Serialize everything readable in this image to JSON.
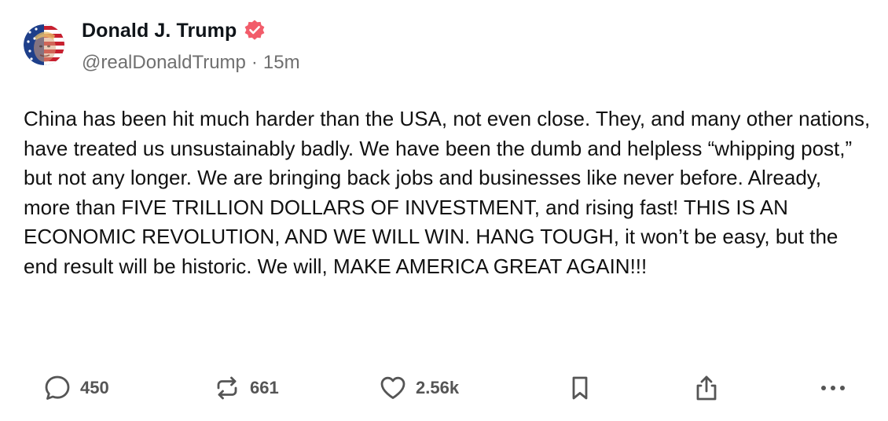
{
  "author": {
    "display_name": "Donald J. Trump",
    "handle": "@realDonaldTrump",
    "separator": "·",
    "timestamp": "15m",
    "verified": true,
    "verified_color": "#f25c6a"
  },
  "post": {
    "text": "China has been hit much harder than the USA, not even close. They, and many other nations, have treated us unsustainably badly. We have been the dumb and helpless “whipping post,” but not any longer. We are bringing back jobs and businesses like never before. Already, more than FIVE TRILLION DOLLARS OF INVESTMENT, and rising fast! THIS IS AN ECONOMIC REVOLUTION, AND WE WILL WIN. HANG TOUGH, it won’t be easy, but the end result will be historic. We will, MAKE AMERICA GREAT AGAIN!!!"
  },
  "actions": {
    "reply": {
      "icon": "reply-icon",
      "count": "450"
    },
    "repost": {
      "icon": "repost-icon",
      "count": "661"
    },
    "like": {
      "icon": "heart-icon",
      "count": "2.56k"
    },
    "bookmark": {
      "icon": "bookmark-icon"
    },
    "share": {
      "icon": "share-icon"
    },
    "more": {
      "icon": "more-icon"
    }
  },
  "colors": {
    "text": "#111111",
    "muted": "#6f6f6f",
    "action_icon": "#555555"
  }
}
